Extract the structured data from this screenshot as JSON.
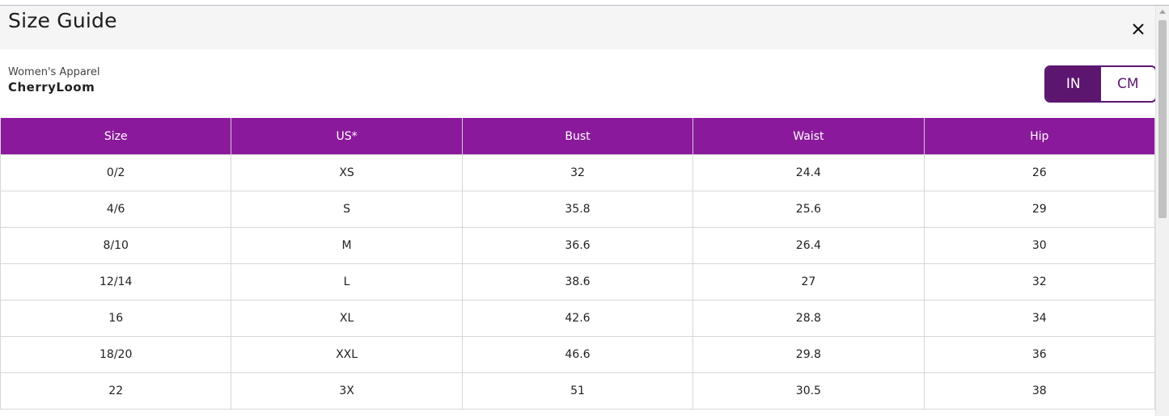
{
  "modal": {
    "title": "Size Guide",
    "close_icon": "close-icon"
  },
  "product": {
    "category": "Women's Apparel",
    "brand": "CherryLoom"
  },
  "unit_toggle": {
    "options": [
      {
        "label": "IN",
        "selected": true
      },
      {
        "label": "CM",
        "selected": false
      }
    ]
  },
  "colors": {
    "header_purple": "#8a1a9b",
    "toggle_purple": "#5c1670"
  },
  "table": {
    "headers": [
      "Size",
      "US*",
      "Bust",
      "Waist",
      "Hip"
    ],
    "rows": [
      [
        "0/2",
        "XS",
        "32",
        "24.4",
        "26"
      ],
      [
        "4/6",
        "S",
        "35.8",
        "25.6",
        "29"
      ],
      [
        "8/10",
        "M",
        "36.6",
        "26.4",
        "30"
      ],
      [
        "12/14",
        "L",
        "38.6",
        "27",
        "32"
      ],
      [
        "16",
        "XL",
        "42.6",
        "28.8",
        "34"
      ],
      [
        "18/20",
        "XXL",
        "46.6",
        "29.8",
        "36"
      ],
      [
        "22",
        "3X",
        "51",
        "30.5",
        "38"
      ]
    ]
  }
}
